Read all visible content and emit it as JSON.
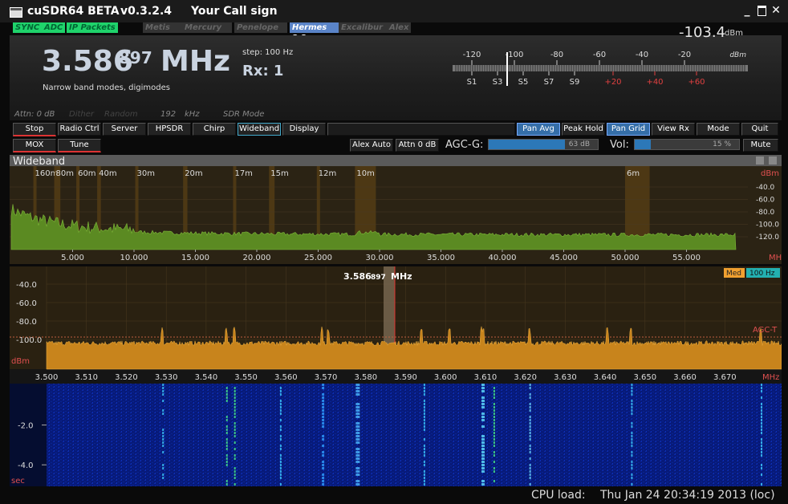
{
  "window": {
    "title": "cuSDR64 BETA",
    "version": "v0.3.2.4",
    "callsign": "Your Call sign"
  },
  "status_chips": [
    "SYNC",
    "ADC",
    "IP Packets"
  ],
  "hardware_chips": [
    "Metis",
    "Mercury",
    "Penelope",
    "Hermes 2.2",
    "Excalibur",
    "Alex"
  ],
  "frequency": {
    "main": "3.586",
    "sub": "897",
    "unit": "MHz",
    "step": "step: 100 Hz",
    "mode_desc": "Narrow band modes, digimodes",
    "receiver": "Rx: 1"
  },
  "info": {
    "attn": "Attn: 0 dB",
    "dither": "Dither",
    "random": "Random",
    "sample_rate": "192",
    "sample_unit": "kHz",
    "sdr_mode": "SDR Mode"
  },
  "meter": {
    "value": "-103.4",
    "unit": "dBm",
    "unit_small": "dBm",
    "top_scale": [
      "-120",
      "-100",
      "-80",
      "-60",
      "-40",
      "-20"
    ],
    "s_scale": [
      "S1",
      "S3",
      "S5",
      "S7",
      "S9"
    ],
    "plus_scale": [
      "+20",
      "+40",
      "+60"
    ]
  },
  "buttons_row1": [
    "Stop",
    "Radio Ctrl",
    "Server",
    "HPSDR",
    "Chirp",
    "Wideband",
    "Display"
  ],
  "buttons_row1_right": [
    "Pan Avg",
    "Peak Hold",
    "Pan Grid",
    "View Rx",
    "Mode",
    "Quit"
  ],
  "buttons_row2": [
    "MOX",
    "Tune"
  ],
  "buttons_row2_mid": [
    "Alex Auto",
    "Attn 0 dB"
  ],
  "agc": {
    "label": "AGC-G:",
    "value": "63 dB",
    "level": 0.7
  },
  "volume": {
    "label": "Vol:",
    "value": "15 %",
    "level": 0.15,
    "mute": "Mute"
  },
  "wideband": {
    "title": "Wideband",
    "bands": [
      "160m",
      "80m",
      "60m",
      "40m",
      "30m",
      "20m",
      "17m",
      "15m",
      "12m",
      "10m",
      "6m"
    ],
    "xticks": [
      "5.000",
      "10.000",
      "15.000",
      "20.000",
      "25.000",
      "30.000",
      "35.000",
      "40.000",
      "45.000",
      "50.000",
      "55.000"
    ],
    "yticks": [
      "-40.0",
      "-60.0",
      "-80.0",
      "-100.0",
      "-120.0"
    ],
    "unit_y": "dBm",
    "unit_x": "MHz"
  },
  "panadapter": {
    "center_main": "3.586",
    "center_sub": "897",
    "center_unit": "MHz",
    "yticks": [
      "-40.0",
      "-60.0",
      "-80.0",
      "-100.0"
    ],
    "xticks": [
      "3.500",
      "3.510",
      "3.520",
      "3.530",
      "3.540",
      "3.550",
      "3.560",
      "3.570",
      "3.580",
      "3.590",
      "3.600",
      "3.610",
      "3.620",
      "3.630",
      "3.640",
      "3.650",
      "3.660",
      "3.670"
    ],
    "unit_y": "dBm",
    "unit_x": "MHz",
    "agc_t": "AGC-T",
    "filter": "Med",
    "bandwidth": "100 Hz"
  },
  "waterfall": {
    "yticks": [
      "-2.0",
      "-4.0"
    ],
    "unit": "sec"
  },
  "statusbar": {
    "cpu": "CPU load:",
    "datetime": "Thu Jan 24 20:34:19 2013 (loc)"
  },
  "colors": {
    "accent": "#2c78b8",
    "green_chip": "#1fd36b",
    "spectrum_wide": "#5b8a22",
    "spectrum_pan": "#c8841c",
    "waterfall_bg": "#03105a"
  }
}
